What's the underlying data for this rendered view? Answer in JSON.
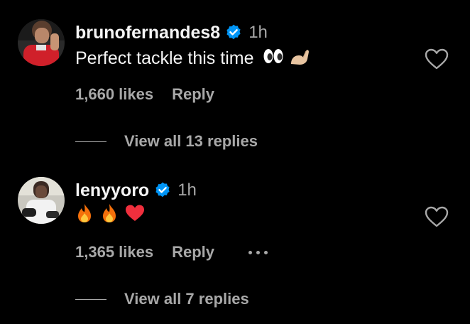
{
  "comments": [
    {
      "username": "brunofernandes8",
      "time": "1h",
      "text": "Perfect tackle this time",
      "emojis": [
        "eyes-emoji",
        "flexed-biceps-emoji"
      ],
      "likes": "1,660 likes",
      "reply_label": "Reply",
      "view_replies": "View all 13 replies"
    },
    {
      "username": "lenyyoro",
      "time": "1h",
      "text": "",
      "emojis": [
        "fire-emoji",
        "fire-emoji",
        "red-heart-emoji"
      ],
      "likes": "1,365 likes",
      "reply_label": "Reply",
      "view_replies": "View all 7 replies"
    }
  ],
  "colors": {
    "background": "#000000",
    "primary_text": "#f5f5f5",
    "secondary_text": "#a8a8a8",
    "verified_badge": "#0095f6"
  },
  "icons": {
    "verified": "verified-badge-icon",
    "like": "heart-outline-icon",
    "more": "more-options-icon"
  }
}
